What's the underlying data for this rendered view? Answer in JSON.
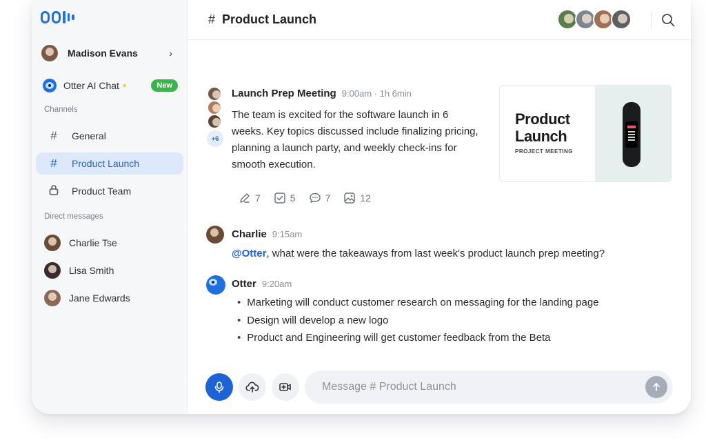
{
  "sidebar": {
    "logo": "Otter",
    "profile": {
      "name": "Madison Evans",
      "avatar_color": "#7a5a44"
    },
    "otter_chat": {
      "label": "Otter AI Chat",
      "badge": "New"
    },
    "channels_label": "Channels",
    "channels": [
      {
        "label": "General",
        "icon": "hash-icon",
        "active": false
      },
      {
        "label": "Product Launch",
        "icon": "hash-icon",
        "active": true
      },
      {
        "label": "Product Team",
        "icon": "lock-icon",
        "active": false
      }
    ],
    "dm_label": "Direct messages",
    "dms": [
      {
        "label": "Charlie Tse",
        "avatar_color": "#6b4a36"
      },
      {
        "label": "Lisa Smith",
        "avatar_color": "#3a2c2a"
      },
      {
        "label": "Jane Edwards",
        "avatar_color": "#8b6a55"
      }
    ]
  },
  "header": {
    "hash": "#",
    "title": "Product Launch",
    "member_colors": [
      "#5a7d4c",
      "#7c8590",
      "#a06f55",
      "#5b5f66"
    ]
  },
  "meeting": {
    "title": "Launch Prep Meeting",
    "meta": "9:00am · 1h 6min",
    "more_count": "+6",
    "summary": "The team is excited for the software launch in 6 weeks. Key topics discussed include finalizing pricing, planning a launch party, and weekly check-ins for smooth execution.",
    "stats": {
      "edits": "7",
      "tasks": "5",
      "comments": "7",
      "images": "12"
    },
    "thumbnail": {
      "title_line1": "Product",
      "title_line2": "Launch",
      "subtitle": "PROJECT MEETING"
    }
  },
  "messages": {
    "charlie": {
      "name": "Charlie",
      "time": "9:15am",
      "mention": "@Otter",
      "text": ", what were the takeaways from last week's product launch prep meeting?"
    },
    "otter": {
      "name": "Otter",
      "time": "9:20am",
      "bullets": [
        "Marketing will conduct customer research on messaging for the landing page",
        "Design will develop a new logo",
        "Product and Engineering will get customer feedback from the Beta"
      ]
    }
  },
  "composer": {
    "placeholder": "Message # Product Launch"
  },
  "colors": {
    "accent": "#1e63d6",
    "badge_green": "#3bb54a",
    "active_bg": "#dde8fb"
  }
}
